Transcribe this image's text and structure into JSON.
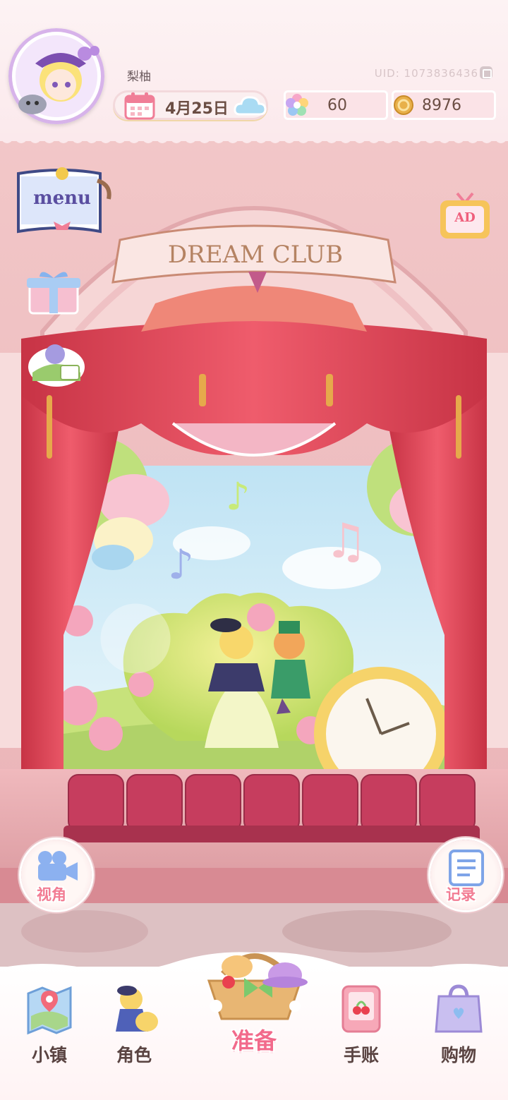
{
  "player": {
    "name": "梨柚",
    "uid": "UID: 1073836436"
  },
  "status_bar": {
    "date": "4月25日",
    "weather_icon": "cloud-icon",
    "gems": "60",
    "coins": "8976"
  },
  "side_buttons": {
    "menu": "menu",
    "ad": "AD",
    "camera": "视角",
    "record": "记录"
  },
  "stage": {
    "banner": "DREAM CLUB"
  },
  "nav": {
    "town": "小镇",
    "role": "角色",
    "prepare": "准备",
    "diary": "手账",
    "shop": "购物"
  },
  "colors": {
    "accent_pink": "#f26a8b",
    "curtain_red": "#e4465a",
    "theatre_pink": "#f4c4c6",
    "seat_red": "#c63d5e"
  }
}
